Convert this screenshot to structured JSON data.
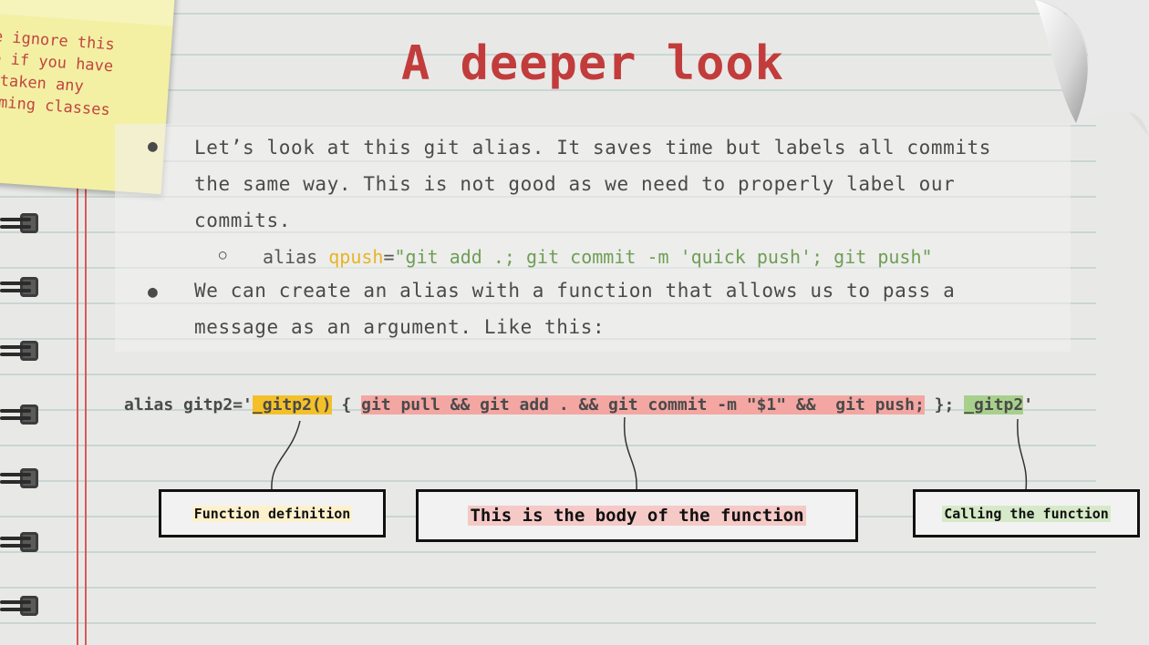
{
  "sticky_note": {
    "text": "se ignore this\nde if you have\nt taken any\nraming classes"
  },
  "title": "A deeper look",
  "bullets": [
    {
      "lines": [
        "Let’s look at this git alias. It saves time but labels all commits",
        "the same way. This is not good as we need to properly label our",
        "commits."
      ]
    },
    {
      "lines": [
        "We can create an alias with a function that allows us to pass a",
        "message as an argument. Like this:"
      ]
    }
  ],
  "sub_bullet": {
    "prefix": "alias ",
    "name": "qpush",
    "eq": "=",
    "value": "\"git add .; git commit -m 'quick push'; git push\""
  },
  "code": {
    "prefix": "alias gitp2='",
    "func_def": "_gitp2()",
    "open_brace": " { ",
    "body": "git pull && git add . && git commit -m \"$1\" &&  git push;",
    "close": " }; ",
    "call": "_gitp2",
    "suffix": "'"
  },
  "callouts": {
    "definition": "Function definition",
    "body": "This is the body of the function",
    "call": "Calling the function"
  },
  "colors": {
    "title": "#c23c3c",
    "func_def_highlight": "#f3c02a",
    "body_highlight": "#f4a6a2",
    "call_highlight": "#a8d08d"
  }
}
